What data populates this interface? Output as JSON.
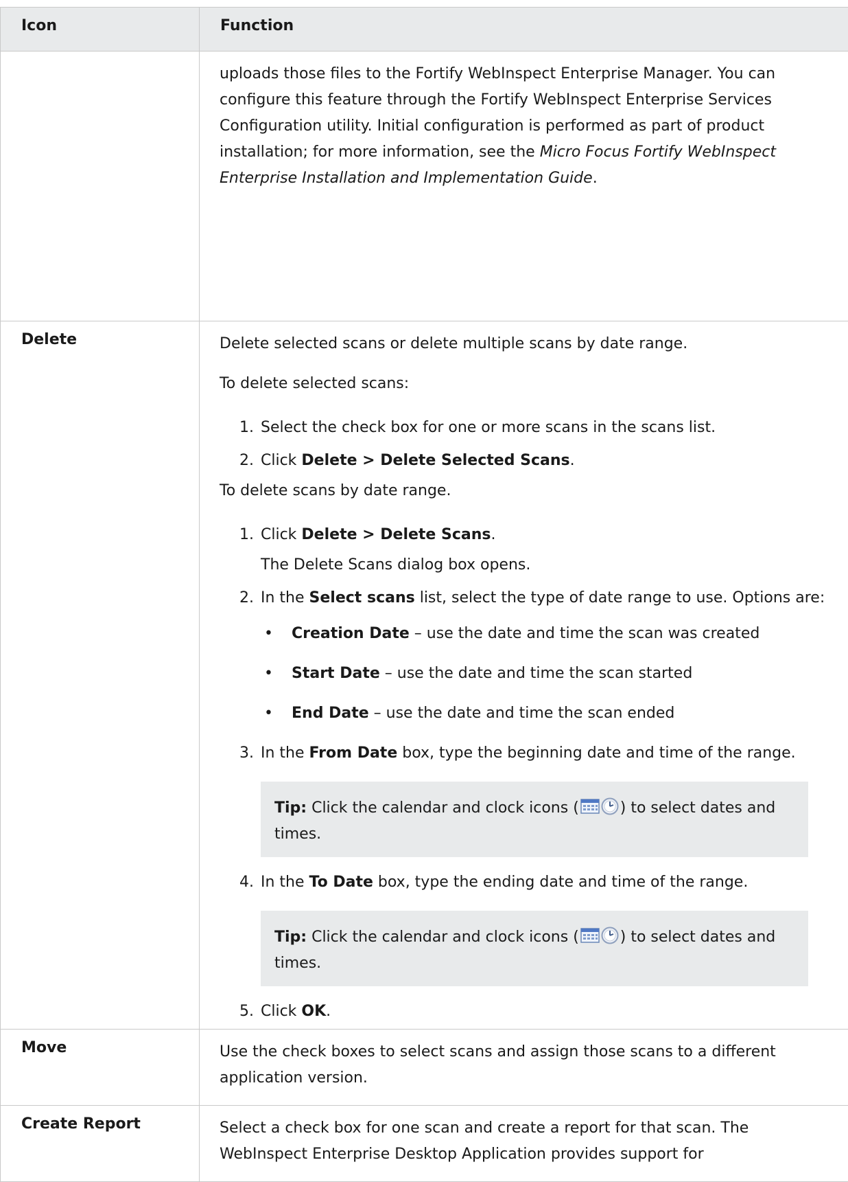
{
  "table": {
    "headers": {
      "icon": "Icon",
      "function": "Function"
    },
    "row_continued": {
      "text_1": "uploads those files to the Fortify WebInspect Enterprise Manager. You can configure this feature through the Fortify WebInspect Enterprise Services Configuration utility. Initial configuration is performed as part of product installation; for more information, see the ",
      "guide_title": "Micro Focus Fortify WebInspect Enterprise Installation and Implementation Guide",
      "text_2": "."
    },
    "row_delete": {
      "icon_label": "Delete",
      "intro": "Delete selected scans or delete multiple scans by date range.",
      "selected_heading": "To delete selected scans:",
      "selected_steps": [
        {
          "num": "1.",
          "text": "Select the check box for one or more scans in the scans list."
        },
        {
          "num": "2.",
          "pre": "Click ",
          "bold": "Delete > Delete Selected Scans",
          "post": "."
        }
      ],
      "range_heading": "To delete scans by date range.",
      "range_step_1": {
        "num": "1.",
        "pre": "Click ",
        "bold": "Delete > Delete Scans",
        "post": ".",
        "sub": "The Delete Scans dialog box opens."
      },
      "range_step_2": {
        "num": "2.",
        "pre": "In the ",
        "bold": "Select scans",
        "post": " list, select the type of date range to use. Options are:"
      },
      "options": [
        {
          "bold": "Creation Date",
          "text": " – use the date and time the scan was created"
        },
        {
          "bold": "Start Date",
          "text": " – use the date and time the scan started"
        },
        {
          "bold": "End Date",
          "text": " – use the date and time the scan ended"
        }
      ],
      "range_step_3": {
        "num": "3.",
        "pre": "In the ",
        "bold": "From Date",
        "post": " box, type the beginning date and time of the range."
      },
      "tip_1": {
        "label": "Tip:",
        "pre": " Click the calendar and clock icons (",
        "post": ") to select dates and times."
      },
      "range_step_4": {
        "num": "4.",
        "pre": "In the ",
        "bold": "To Date",
        "post": " box, type the ending date and time of the range."
      },
      "tip_2": {
        "label": "Tip:",
        "pre": " Click the calendar and clock icons (",
        "post": ") to select dates and times."
      },
      "range_step_5": {
        "num": "5.",
        "pre": "Click ",
        "bold": "OK",
        "post": "."
      }
    },
    "row_move": {
      "icon_label": "Move",
      "text": "Use the check boxes to select scans and assign those scans to a different application version."
    },
    "row_report": {
      "icon_label": "Create Report",
      "text": "Select a check box for one scan and create a report for that scan. The WebInspect Enterprise Desktop Application provides support for"
    }
  },
  "icons": [
    "calendar-icon",
    "clock-icon"
  ],
  "colors": {
    "header_bg": "#e8eaeb",
    "tip_bg": "#e8eaeb",
    "border": "#c9c9c9",
    "text": "#1a1a1a"
  }
}
